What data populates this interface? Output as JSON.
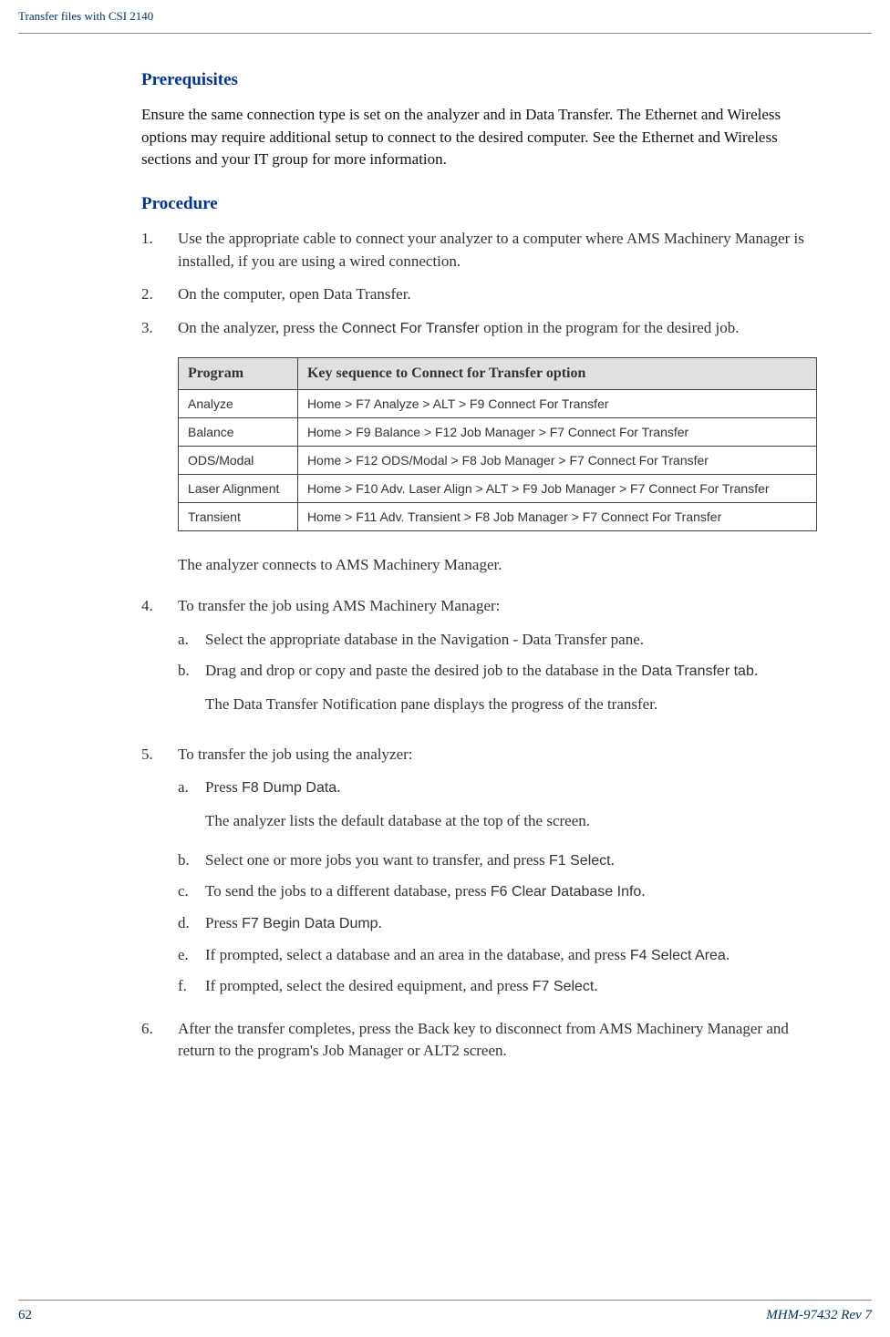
{
  "header": {
    "title": "Transfer files with CSI 2140"
  },
  "sections": {
    "prerequisites": {
      "heading": "Prerequisites",
      "body": "Ensure the same connection type is set on the analyzer and in Data Transfer. The Ethernet and Wireless options may require additional setup to connect to the desired computer. See the Ethernet and Wireless sections and your IT group for more information."
    },
    "procedure": {
      "heading": "Procedure",
      "steps": [
        {
          "num": "1.",
          "text": "Use the appropriate cable to connect your analyzer to a computer where AMS Machinery Manager is installed, if you are using a wired connection."
        },
        {
          "num": "2.",
          "text": "On the computer, open Data Transfer."
        },
        {
          "num": "3.",
          "text_pre": "On the analyzer, press the ",
          "ui_text": "Connect For Transfer",
          "text_post": " option in the program for the desired job."
        }
      ],
      "table": {
        "headers": {
          "col1": "Program",
          "col2": "Key sequence to Connect for Transfer option"
        },
        "rows": [
          {
            "program": "Analyze",
            "sequence": "Home > F7 Analyze > ALT > F9 Connect For Transfer"
          },
          {
            "program": "Balance",
            "sequence": "Home > F9 Balance > F12 Job Manager > F7 Connect For Transfer"
          },
          {
            "program": "ODS/Modal",
            "sequence": "Home > F12 ODS/Modal > F8 Job Manager > F7 Connect For Transfer"
          },
          {
            "program": "Laser Alignment",
            "sequence": "Home > F10 Adv. Laser Align > ALT > F9 Job Manager > F7 Connect For Transfer"
          },
          {
            "program": "Transient",
            "sequence": "Home > F11 Adv. Transient > F8 Job Manager > F7 Connect For Transfer"
          }
        ]
      },
      "post_table": "The analyzer connects to AMS Machinery Manager.",
      "step4": {
        "num": "4.",
        "text": "To transfer the job using AMS Machinery Manager:",
        "substeps": [
          {
            "letter": "a.",
            "text": "Select the appropriate database in the Navigation - Data Transfer pane."
          },
          {
            "letter": "b.",
            "text_pre": "Drag and drop or copy and paste the desired job to the database in the ",
            "ui_text": "Data Transfer tab",
            "text_post": "."
          }
        ],
        "result": "The Data Transfer Notification pane displays the progress of the transfer."
      },
      "step5": {
        "num": "5.",
        "text": "To transfer the job using the analyzer:",
        "substeps_a": {
          "letter": "a.",
          "text_pre": "Press ",
          "ui_text": "F8 Dump Data",
          "text_post": "."
        },
        "result_a": "The analyzer lists the default database at the top of the screen.",
        "substeps_b": {
          "letter": "b.",
          "text_pre": "Select one or more jobs you want to transfer, and press ",
          "ui_text": "F1 Select",
          "text_post": "."
        },
        "substeps_c": {
          "letter": "c.",
          "text_pre": "To send the jobs to a different database, press ",
          "ui_text": "F6 Clear Database Info",
          "text_post": "."
        },
        "substeps_d": {
          "letter": "d.",
          "text_pre": "Press ",
          "ui_text": "F7 Begin Data Dump",
          "text_post": "."
        },
        "substeps_e": {
          "letter": "e.",
          "text_pre": "If prompted, select a database and an area in the database, and press ",
          "ui_text": "F4 Select Area",
          "text_post": "."
        },
        "substeps_f": {
          "letter": "f.",
          "text_pre": "If prompted, select the desired equipment, and press ",
          "ui_text": "F7 Select",
          "text_post": "."
        }
      },
      "step6": {
        "num": "6.",
        "text": "After the transfer completes, press the Back key to disconnect from AMS Machinery Manager and return to the program's Job Manager or ALT2 screen."
      }
    }
  },
  "footer": {
    "page_number": "62",
    "doc_ref": "MHM-97432 Rev 7"
  }
}
